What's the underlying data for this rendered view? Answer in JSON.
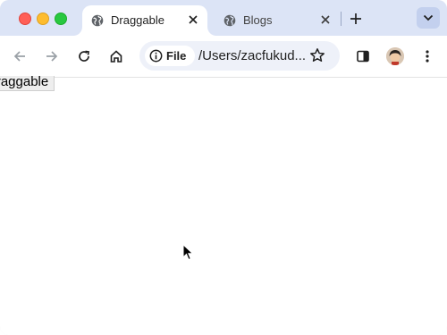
{
  "browser": {
    "tabs": [
      {
        "title": "Draggable",
        "active": true,
        "favicon": "globe-icon"
      },
      {
        "title": "Blogs",
        "active": false,
        "favicon": "globe-icon"
      }
    ],
    "toolbar": {
      "site_chip": "File",
      "url": "/Users/zacfukud..."
    }
  },
  "page": {
    "draggable_label": "Draggable"
  },
  "colors": {
    "tabstrip_bg": "#dce4f6",
    "omnibox_bg": "#eef1f9"
  }
}
